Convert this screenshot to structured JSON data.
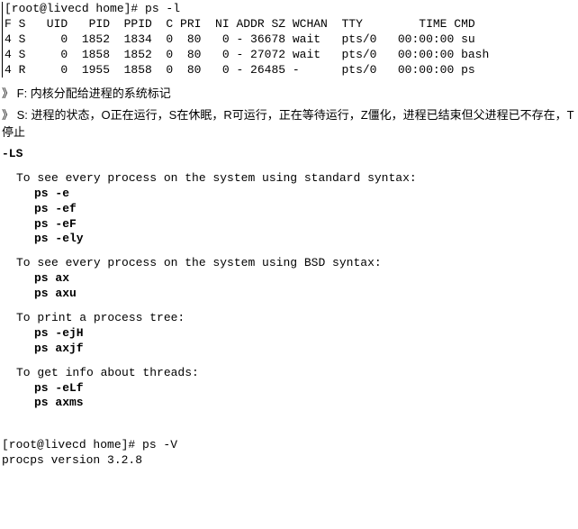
{
  "term1": {
    "prompt": "[root@livecd home]# ps -l",
    "header": "F S   UID   PID  PPID  C PRI  NI ADDR SZ WCHAN  TTY        TIME CMD",
    "rows": [
      "4 S     0  1852  1834  0  80   0 - 36678 wait   pts/0   00:00:00 su",
      "4 S     0  1858  1852  0  80   0 - 27072 wait   pts/0   00:00:00 bash",
      "4 R     0  1955  1858  0  80   0 - 26485 -      pts/0   00:00:00 ps"
    ]
  },
  "annotations": {
    "marker": "》",
    "line1": "F: 内核分配给进程的系统标记",
    "line2": "S: 进程的状态，O正在运行，S在休眠，R可运行，正在等待运行，Z僵化，进程已结束但父进程已不存在，T停止"
  },
  "help": {
    "prefix": "-LS",
    "sec1_title": "To see every process on the system using standard syntax:",
    "sec1_cmds": [
      "ps -e",
      "ps -ef",
      "ps -eF",
      "ps -ely"
    ],
    "sec2_title": "To see every process on the system using BSD syntax:",
    "sec2_cmds": [
      "ps ax",
      "ps axu"
    ],
    "sec3_title": "To print a process tree:",
    "sec3_cmds": [
      "ps -ejH",
      "ps axjf"
    ],
    "sec4_title": "To get info about threads:",
    "sec4_cmds": [
      "ps -eLf",
      "ps axms"
    ]
  },
  "term2": {
    "prompt": "[root@livecd home]# ps -V",
    "output": "procps version 3.2.8"
  }
}
